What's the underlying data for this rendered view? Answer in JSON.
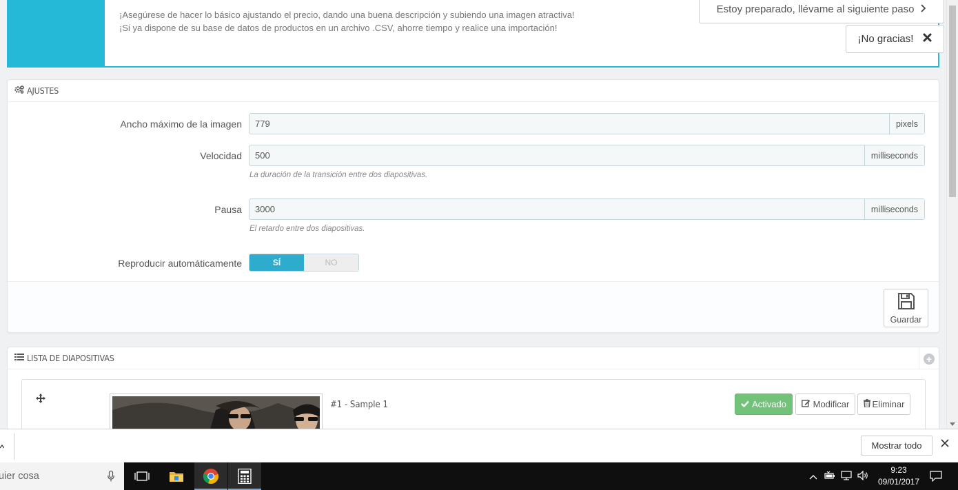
{
  "banner": {
    "line1": "¡Asegúrese de hacer lo básico ajustando el precio, dando una buena descripción y subiendo una imagen atractiva!",
    "line2": "¡Si ya dispone de su base de datos de productos en un archivo .CSV, ahorre tiempo y realice una importación!",
    "next_label": "Estoy preparado, llévame al siguiente paso",
    "no_thanks_label": "¡No gracias!"
  },
  "settings": {
    "heading": "AJUSTES",
    "fields": [
      {
        "label": "Ancho máximo de la imagen",
        "value": "779",
        "unit": "pixels",
        "help": ""
      },
      {
        "label": "Velocidad",
        "value": "500",
        "unit": "milliseconds",
        "help": "La duración de la transición entre dos diapositivas."
      },
      {
        "label": "Pausa",
        "value": "3000",
        "unit": "milliseconds",
        "help": "El retardo entre dos diapositivas."
      }
    ],
    "autoplay": {
      "label": "Reproducir automáticamente",
      "yes": "SÍ",
      "no": "NO",
      "selected": "yes"
    },
    "save_label": "Guardar"
  },
  "slides": {
    "heading": "LISTA DE DIAPOSITIVAS",
    "items": [
      {
        "title": "#1 - Sample 1",
        "status_label": "Activado",
        "edit_label": "Modificar",
        "delete_label": "Eliminar"
      }
    ]
  },
  "download_bar": {
    "show_all_label": "Mostrar todo"
  },
  "taskbar": {
    "search_text": "uier cosa",
    "time": "9:23",
    "date": "09/01/2017"
  },
  "colors": {
    "accent": "#25b9d7",
    "switch_on": "#2eacce",
    "active_button": "#72c279"
  }
}
